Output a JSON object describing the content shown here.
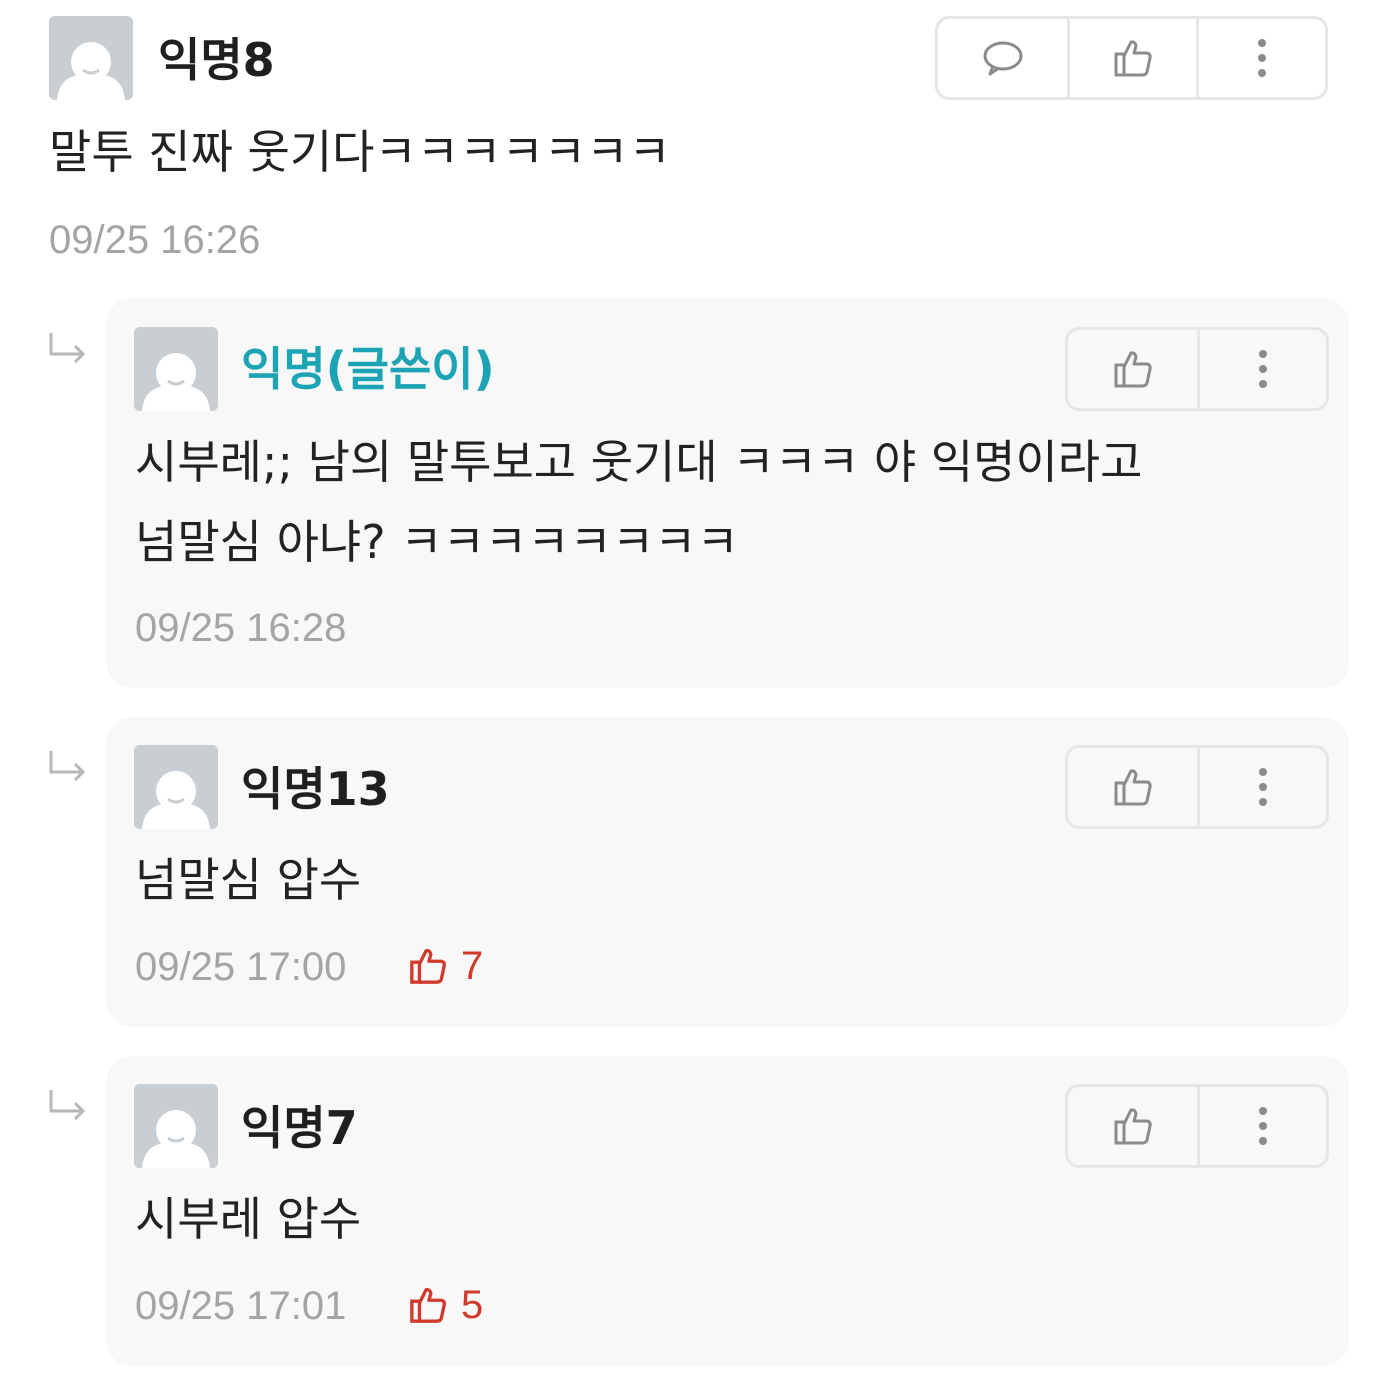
{
  "comments": [
    {
      "author": "익명8",
      "text": "말투 진짜 웃기다ㅋㅋㅋㅋㅋㅋㅋ",
      "time": "09/25 16:26"
    }
  ],
  "replies": [
    {
      "author": "익명(글쓴이)",
      "is_author": true,
      "text_lines": [
        "시부레;; 남의 말투보고 웃기대 ㅋㅋㅋ 야 익명이라고",
        "넘말심 아냐? ㅋㅋㅋㅋㅋㅋㅋㅋ"
      ],
      "time": "09/25 16:28"
    },
    {
      "author": "익명13",
      "is_author": false,
      "text_lines": [
        "넘말심 압수"
      ],
      "time": "09/25 17:00",
      "likes": "7"
    },
    {
      "author": "익명7",
      "is_author": false,
      "text_lines": [
        "시부레 압수"
      ],
      "time": "09/25 17:01",
      "likes": "5"
    }
  ],
  "icons": {
    "reply": "speech-bubble-icon",
    "like": "thumbs-up-icon",
    "more": "more-vertical-icon",
    "reply_arrow": "reply-arrow-icon",
    "avatar": "default-avatar-icon"
  },
  "colors": {
    "author_name": "#1ca3b4",
    "vote": "#d03a2c",
    "timestamp": "#a4a4a4",
    "card_bg": "#f8f8f8"
  }
}
